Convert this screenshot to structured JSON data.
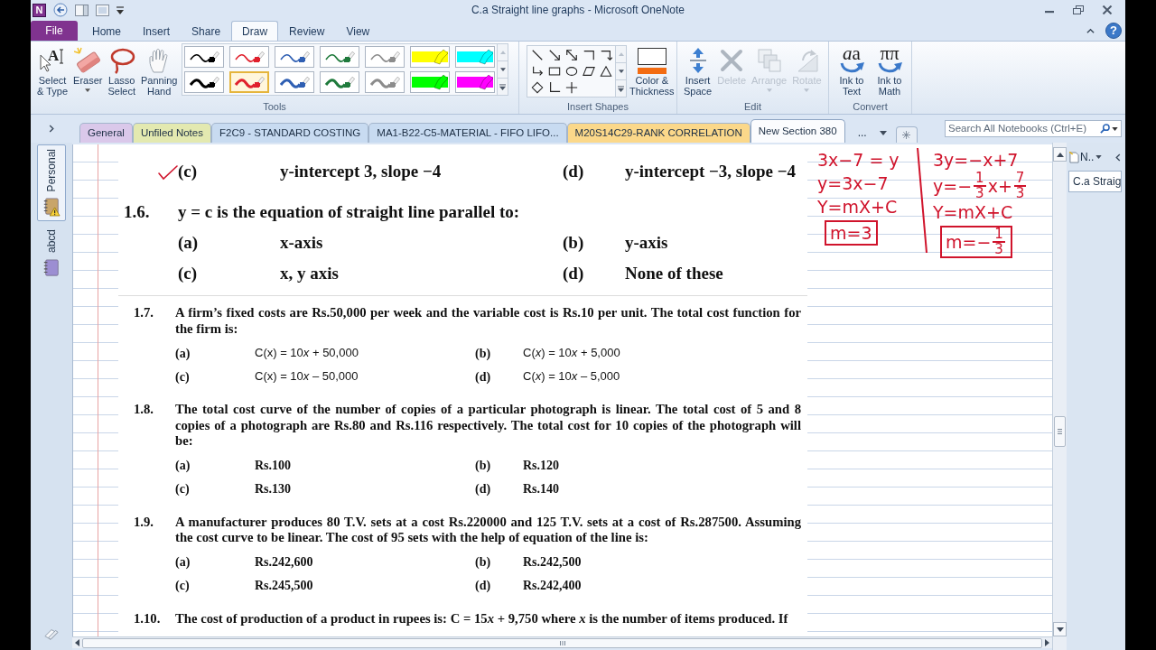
{
  "title_bar": {
    "logo_text": "N",
    "title": "C.a Straight line graphs - Microsoft OneNote",
    "help_label": "?"
  },
  "ribbon": {
    "tabs": [
      {
        "label": "File",
        "kind": "file",
        "selected": false
      },
      {
        "label": "Home",
        "kind": "tab",
        "selected": false
      },
      {
        "label": "Insert",
        "kind": "tab",
        "selected": false
      },
      {
        "label": "Share",
        "kind": "tab",
        "selected": false
      },
      {
        "label": "Draw",
        "kind": "tab",
        "selected": true
      },
      {
        "label": "Review",
        "kind": "tab",
        "selected": false
      },
      {
        "label": "View",
        "kind": "tab",
        "selected": false
      }
    ],
    "groups": [
      {
        "label": "Tools",
        "items": [
          {
            "kind": "select",
            "label": "Select\n& Type",
            "glyph": "A",
            "dropdown": false,
            "disabled": false
          },
          {
            "kind": "eraser",
            "label": "Eraser",
            "dropdown": true,
            "disabled": false
          },
          {
            "kind": "lasso",
            "label": "Lasso\nSelect",
            "dropdown": false,
            "disabled": false
          },
          {
            "kind": "pan",
            "label": "Panning\nHand",
            "dropdown": false,
            "disabled": false
          },
          {
            "kind": "pens",
            "pens": [
              {
                "color": "#000000",
                "kind": "pen",
                "thick": false,
                "selected": false
              },
              {
                "color": "#e0202c",
                "kind": "pen",
                "thick": false,
                "selected": false
              },
              {
                "color": "#2f5fb3",
                "kind": "pen",
                "thick": false,
                "selected": false
              },
              {
                "color": "#1f7a3c",
                "kind": "pen",
                "thick": false,
                "selected": false
              },
              {
                "color": "#8c8c8c",
                "kind": "pen",
                "thick": false,
                "selected": false
              },
              {
                "color": "#ffff00",
                "kind": "highlighter",
                "thick": false,
                "selected": false
              },
              {
                "color": "#00ffff",
                "kind": "highlighter",
                "thick": false,
                "selected": false
              },
              {
                "color": "#000000",
                "kind": "pen",
                "thick": true,
                "selected": false
              },
              {
                "color": "#e0202c",
                "kind": "pen",
                "thick": true,
                "selected": true
              },
              {
                "color": "#2f5fb3",
                "kind": "pen",
                "thick": true,
                "selected": false
              },
              {
                "color": "#1f7a3c",
                "kind": "pen",
                "thick": true,
                "selected": false
              },
              {
                "color": "#8c8c8c",
                "kind": "pen",
                "thick": true,
                "selected": false
              },
              {
                "color": "#00ff00",
                "kind": "highlighter",
                "thick": false,
                "selected": false
              },
              {
                "color": "#ff00ff",
                "kind": "highlighter",
                "thick": false,
                "selected": false
              }
            ]
          }
        ]
      },
      {
        "label": "Insert Shapes",
        "items": [
          {
            "kind": "shapes"
          },
          {
            "kind": "color",
            "label": "Color &\nThickness",
            "dropdown": false,
            "disabled": false
          }
        ]
      },
      {
        "label": "Edit",
        "items": [
          {
            "kind": "insert_space",
            "label": "Insert\nSpace",
            "dropdown": false,
            "disabled": false
          },
          {
            "kind": "delete",
            "label": "Delete",
            "dropdown": false,
            "disabled": true
          },
          {
            "kind": "arrange",
            "label": "Arrange",
            "dropdown": true,
            "disabled": true
          },
          {
            "kind": "rotate",
            "label": "Rotate",
            "dropdown": true,
            "disabled": true
          }
        ]
      },
      {
        "label": "Convert",
        "items": [
          {
            "kind": "ink_to_text",
            "label": "Ink to\nText",
            "glyph": [
              {
                "t": "a",
                "italic": true
              },
              {
                "t": "a",
                "italic": false
              }
            ],
            "dropdown": false,
            "disabled": false
          },
          {
            "kind": "ink_to_math",
            "label": "Ink to\nMath",
            "glyph": "ππ",
            "dropdown": false,
            "disabled": false
          }
        ]
      }
    ]
  },
  "section_tabs": {
    "tabs": [
      {
        "label": "General",
        "color": "#dac8ea",
        "selected": false
      },
      {
        "label": "Unfiled Notes",
        "color": "#e3e9b0",
        "selected": false
      },
      {
        "label": "F2C9 - STANDARD COSTING",
        "color": "#c8dbf1",
        "selected": false
      },
      {
        "label": "MA1-B22-C5-MATERIAL - FIFO LIFO...",
        "color": "#c8dbf1",
        "selected": false
      },
      {
        "label": "M20S14C29-RANK CORRELATION",
        "color": "#fbd88a",
        "selected": false
      },
      {
        "label": "New Section 380",
        "color": "#fbfcfe",
        "selected": true
      }
    ],
    "overflow_label": "...",
    "search": {
      "placeholder": "Search All Notebooks (Ctrl+E)"
    }
  },
  "notebooks": [
    {
      "label": "Personal",
      "color": "#c9a56a",
      "sync_warning": true,
      "selected": true
    },
    {
      "label": "abcd",
      "color": "#9c8ed2",
      "sync_warning": false,
      "selected": false
    }
  ],
  "page": {
    "questions": [
      {
        "kind": "large",
        "options": [
          {
            "label": "(c)",
            "text": "y-intercept 3, slope −4",
            "ticked": true
          },
          {
            "label": "(d)",
            "text": "y-intercept −3, slope −4",
            "ticked": false
          }
        ]
      },
      {
        "kind": "large",
        "number": "1.6.",
        "text": "y = c is the equation of straight line parallel to:",
        "options": [
          {
            "label": "(a)",
            "text": "x-axis",
            "ticked": false
          },
          {
            "label": "(b)",
            "text": "y-axis",
            "ticked": false
          },
          {
            "label": "(c)",
            "text": "x, y axis",
            "ticked": false
          },
          {
            "label": "(d)",
            "text": "None of these",
            "ticked": false
          }
        ]
      },
      {
        "kind": "formula",
        "number": "1.7.",
        "text": "A firm’s fixed costs are Rs.50,000 per week and the variable cost is Rs.10 per unit. The total cost function for the firm is:",
        "options": [
          {
            "label": "(a)",
            "text": [
              {
                "t": "C(x) = 10",
                "italic": false
              },
              {
                "t": "x",
                "italic": true
              },
              {
                "t": " + 50,000",
                "italic": false
              }
            ],
            "ticked": false
          },
          {
            "label": "(b)",
            "text": [
              {
                "t": "C(",
                "italic": false
              },
              {
                "t": "x",
                "italic": true
              },
              {
                "t": ") = 10",
                "italic": false
              },
              {
                "t": "x",
                "italic": true
              },
              {
                "t": " + 5,000",
                "italic": false
              }
            ],
            "ticked": false
          },
          {
            "label": "(c)",
            "text": [
              {
                "t": "C(x) = 10",
                "italic": false
              },
              {
                "t": "x",
                "italic": true
              },
              {
                "t": " – 50,000",
                "italic": false
              }
            ],
            "ticked": false
          },
          {
            "label": "(d)",
            "text": [
              {
                "t": "C(",
                "italic": false
              },
              {
                "t": "x",
                "italic": true
              },
              {
                "t": ") = 10",
                "italic": false
              },
              {
                "t": "x",
                "italic": true
              },
              {
                "t": " – 5,000",
                "italic": false
              }
            ],
            "ticked": false
          }
        ]
      },
      {
        "kind": "compact",
        "number": "1.8.",
        "text": "The total cost curve of the number of copies of a particular photograph is linear. The total cost of 5 and 8 copies of a photograph are Rs.80 and Rs.116 respectively. The total cost for 10 copies of the photograph will be:",
        "options": [
          {
            "label": "(a)",
            "text": "Rs.100",
            "ticked": false
          },
          {
            "label": "(b)",
            "text": "Rs.120",
            "ticked": false
          },
          {
            "label": "(c)",
            "text": "Rs.130",
            "ticked": false
          },
          {
            "label": "(d)",
            "text": "Rs.140",
            "ticked": false
          }
        ]
      },
      {
        "kind": "compact",
        "number": "1.9.",
        "text": "A manufacturer produces 80 T.V. sets at a cost Rs.220000 and 125 T.V. sets at a cost of Rs.287500. Assuming the cost curve to be linear. The cost of 95 sets with the help of equation of the line is:",
        "options": [
          {
            "label": "(a)",
            "text": "Rs.242,600",
            "ticked": false
          },
          {
            "label": "(b)",
            "text": "Rs.242,500",
            "ticked": false
          },
          {
            "label": "(c)",
            "text": "Rs.245,500",
            "ticked": false
          },
          {
            "label": "(d)",
            "text": "Rs.242,400",
            "ticked": false
          }
        ]
      },
      {
        "kind": "compact",
        "number": "1.10.",
        "text": [
          {
            "t": "The cost of production of a product in rupees is: C = 15",
            "italic": false
          },
          {
            "t": "x",
            "italic": true
          },
          {
            "t": " + 9,750 where ",
            "italic": false
          },
          {
            "t": "x",
            "italic": true
          },
          {
            "t": " is the number of items produced. If",
            "italic": false
          }
        ]
      }
    ]
  },
  "ink": {
    "columns": [
      [
        {
          "segments": [
            "3x−7 = y"
          ],
          "boxed": false
        },
        {
          "segments": [
            "y=3x−7"
          ],
          "boxed": false
        },
        {
          "segments": [
            "Y=mX+C"
          ],
          "boxed": false
        },
        {
          "segments": [
            "m=3"
          ],
          "boxed": true
        }
      ],
      [
        {
          "segments": [
            "3y=−x+7"
          ],
          "boxed": false
        },
        {
          "segments": [
            "y=−",
            {
              "num": "1",
              "den": "3"
            },
            "x+",
            {
              "num": "7",
              "den": "3"
            }
          ],
          "boxed": false
        },
        {
          "segments": [
            "Y=mX+C"
          ],
          "boxed": false
        },
        {
          "segments": [
            "m=−",
            {
              "num": "1",
              "den": "3"
            }
          ],
          "boxed": true
        }
      ]
    ]
  },
  "page_list": {
    "new_page_label": "N..",
    "pages": [
      {
        "title": "C.a Straig",
        "selected": true
      }
    ]
  }
}
